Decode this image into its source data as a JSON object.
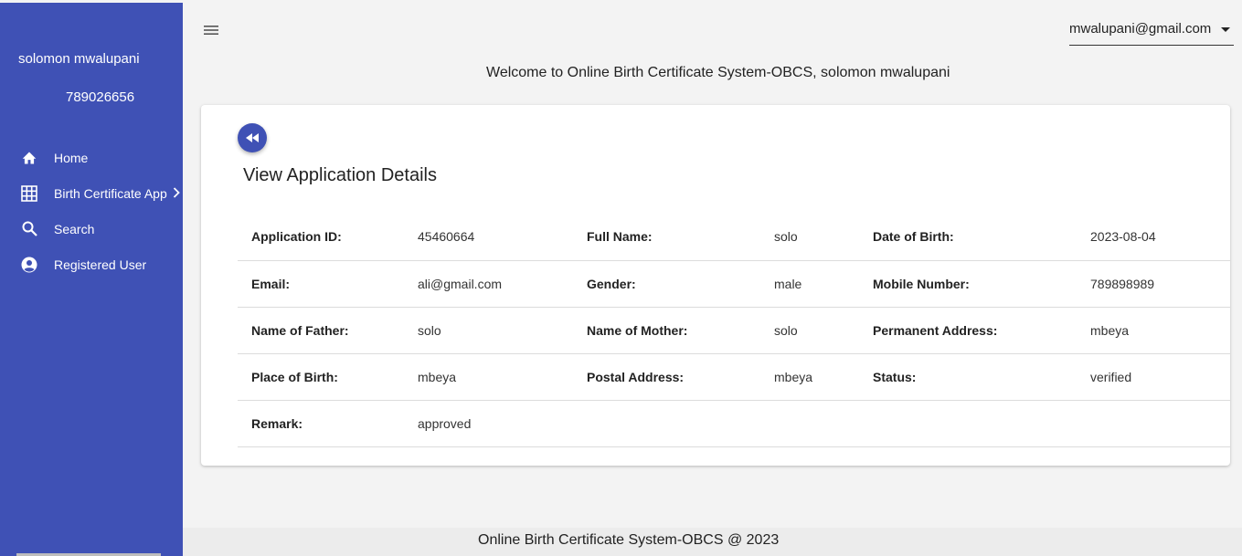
{
  "sidebar": {
    "user_name": "solomon mwalupani",
    "user_phone": "789026656",
    "items": [
      {
        "label": "Home",
        "icon": "home-icon"
      },
      {
        "label": "Birth Certificate App",
        "icon": "grid-icon"
      },
      {
        "label": "Search",
        "icon": "search-icon"
      },
      {
        "label": "Registered User",
        "icon": "account-icon"
      }
    ]
  },
  "header": {
    "user_email": "mwalupani@gmail.com",
    "welcome": "Welcome to Online Birth Certificate System-OBCS, solomon mwalupani"
  },
  "card": {
    "title": "View Application Details",
    "rows": [
      [
        {
          "key": "Application ID:",
          "value": "45460664"
        },
        {
          "key": "Full Name:",
          "value": "solo"
        },
        {
          "key": "Date of Birth:",
          "value": "2023-08-04"
        }
      ],
      [
        {
          "key": "Email:",
          "value": "ali@gmail.com"
        },
        {
          "key": "Gender:",
          "value": "male"
        },
        {
          "key": "Mobile Number:",
          "value": "789898989"
        }
      ],
      [
        {
          "key": "Name of Father:",
          "value": "solo"
        },
        {
          "key": "Name of Mother:",
          "value": "solo"
        },
        {
          "key": "Permanent Address:",
          "value": "mbeya"
        }
      ],
      [
        {
          "key": "Place of Birth:",
          "value": "mbeya"
        },
        {
          "key": "Postal Address:",
          "value": "mbeya"
        },
        {
          "key": "Status:",
          "value": "verified"
        }
      ],
      [
        {
          "key": "Remark:",
          "value": "approved"
        }
      ]
    ]
  },
  "footer": {
    "text": "Online Birth Certificate System-OBCS @ 2023"
  },
  "colors": {
    "primary": "#3f51b5",
    "background": "#f3f3f3"
  }
}
